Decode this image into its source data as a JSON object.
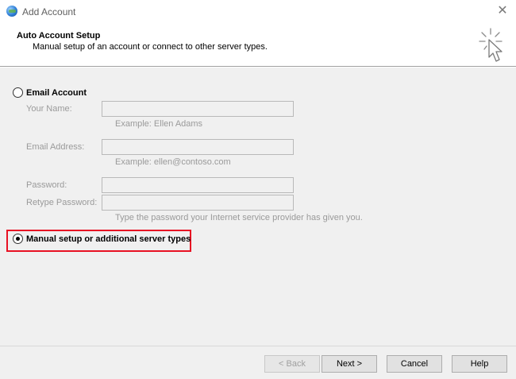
{
  "window": {
    "title": "Add Account",
    "close_glyph": "✕",
    "icon": "outlook-globe-icon"
  },
  "header": {
    "title": "Auto Account Setup",
    "subtitle": "Manual setup of an account or connect to other server types.",
    "icon": "cursor-click-icon"
  },
  "options": {
    "email_account": {
      "label": "Email Account",
      "selected": false
    },
    "manual_setup": {
      "label": "Manual setup or additional server types",
      "selected": true
    }
  },
  "fields": {
    "your_name": {
      "label": "Your Name:",
      "value": "",
      "hint": "Example: Ellen Adams"
    },
    "email_address": {
      "label": "Email Address:",
      "value": "",
      "hint": "Example: ellen@contoso.com"
    },
    "password": {
      "label": "Password:",
      "value": ""
    },
    "retype_password": {
      "label": "Retype Password:",
      "value": "",
      "hint": "Type the password your Internet service provider has given you."
    }
  },
  "footer": {
    "back_label": "< Back",
    "next_label": "Next >",
    "cancel_label": "Cancel",
    "help_label": "Help"
  },
  "colors": {
    "highlight": "#e81123",
    "dialog_bg": "#f0f0f0",
    "disabled_text": "#9a9a9a"
  }
}
